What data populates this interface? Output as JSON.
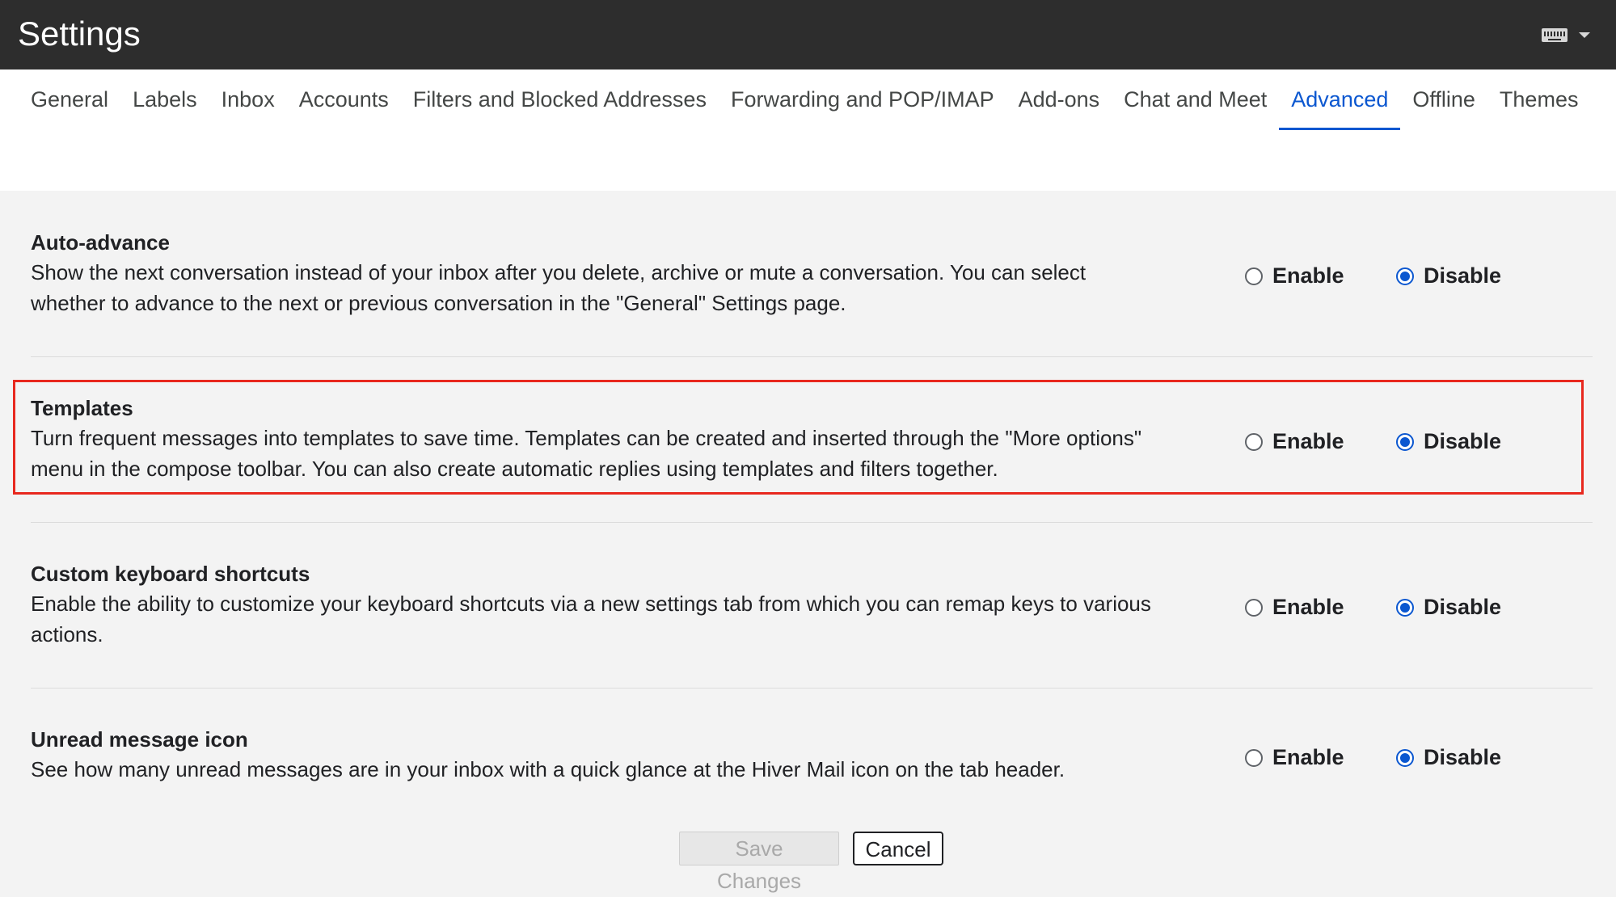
{
  "header": {
    "title": "Settings",
    "keyboard_icon": "keyboard-icon",
    "caret_icon": "chevron-down-icon"
  },
  "tabs": [
    {
      "label": "General",
      "active": false
    },
    {
      "label": "Labels",
      "active": false
    },
    {
      "label": "Inbox",
      "active": false
    },
    {
      "label": "Accounts",
      "active": false
    },
    {
      "label": "Filters and Blocked Addresses",
      "active": false
    },
    {
      "label": "Forwarding and POP/IMAP",
      "active": false
    },
    {
      "label": "Add-ons",
      "active": false
    },
    {
      "label": "Chat and Meet",
      "active": false
    },
    {
      "label": "Advanced",
      "active": true
    },
    {
      "label": "Offline",
      "active": false
    },
    {
      "label": "Themes",
      "active": false
    }
  ],
  "settings": [
    {
      "name": "Auto-advance",
      "description": "Show the next conversation instead of your inbox after you delete, archive or mute a conversation. You can select whether to advance to the next or previous conversation in the \"General\" Settings page.",
      "enable_label": "Enable",
      "disable_label": "Disable",
      "selected": "Disable"
    },
    {
      "name": "Templates",
      "description": "Turn frequent messages into templates to save time. Templates can be created and inserted through the \"More options\" menu in the compose toolbar. You can also create automatic replies using templates and filters together.",
      "enable_label": "Enable",
      "disable_label": "Disable",
      "selected": "Disable"
    },
    {
      "name": "Custom keyboard shortcuts",
      "description": "Enable the ability to customize your keyboard shortcuts via a new settings tab from which you can remap keys to various actions.",
      "enable_label": "Enable",
      "disable_label": "Disable",
      "selected": "Disable"
    },
    {
      "name": "Unread message icon",
      "description": "See how many unread messages are in your inbox with a quick glance at the Hiver Mail icon on the tab header.",
      "enable_label": "Enable",
      "disable_label": "Disable",
      "selected": "Disable"
    }
  ],
  "footer": {
    "save_label": "Save Changes",
    "cancel_label": "Cancel"
  },
  "colors": {
    "accent": "#0b57d0",
    "header_bg": "#2d2d2d",
    "highlight_border": "#e8281e"
  }
}
